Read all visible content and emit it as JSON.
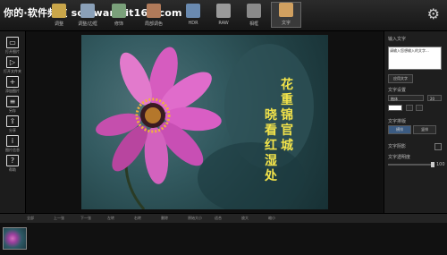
{
  "watermark": "你的·软件频道 software.it168.com",
  "toolbar": {
    "items": [
      {
        "label": "调整",
        "icon": "adjust-icon",
        "color": "#c9a64a"
      },
      {
        "label": "调整/边框",
        "icon": "frame-icon",
        "color": "#8aa0b8"
      },
      {
        "label": "修饰",
        "icon": "retouch-icon",
        "color": "#7aa07a"
      },
      {
        "label": "局部调色",
        "icon": "color-icon",
        "color": "#b07a5a"
      },
      {
        "label": "HDR",
        "icon": "hdr-icon",
        "color": "#6a8ab0"
      },
      {
        "label": "RAW",
        "icon": "raw-icon",
        "color": "#9a9a9a"
      },
      {
        "label": "相框",
        "icon": "film-icon",
        "color": "#8a8a8a"
      },
      {
        "label": "文字",
        "icon": "text-icon",
        "color": "#d0a060"
      }
    ],
    "settings_icon": "⚙"
  },
  "sidebar": {
    "items": [
      {
        "label": "打开图片",
        "glyph": "▭"
      },
      {
        "label": "打开文件夹",
        "glyph": "▷"
      },
      {
        "label": "添加图片",
        "glyph": "+"
      },
      {
        "label": "另存",
        "glyph": "≡"
      },
      {
        "label": "分享",
        "glyph": "⇪"
      },
      {
        "label": "图片信息",
        "glyph": "i"
      },
      {
        "label": "帮助",
        "glyph": "?"
      }
    ]
  },
  "canvas": {
    "poem_col1": "花重锦官城",
    "poem_col2": "晓看红湿处"
  },
  "panel": {
    "input_label": "输入文字",
    "input_placeholder": "请输入您想输入的文字...",
    "apply_button": "应用文字",
    "settings_label": "文字设置",
    "font_value": "楷体",
    "size_value": "20",
    "color_value": "",
    "alignment_label": "文字排版",
    "horizontal_button": "横排",
    "vertical_button": "竖排",
    "shadow_label": "文字阴影",
    "opacity_label": "文字透明度",
    "opacity_value": "100"
  },
  "bottombar": {
    "items": [
      "全部",
      "上一张",
      "下一张",
      "左转",
      "右转",
      "删除",
      "原始大小",
      "适合",
      "放大",
      "缩小"
    ]
  }
}
